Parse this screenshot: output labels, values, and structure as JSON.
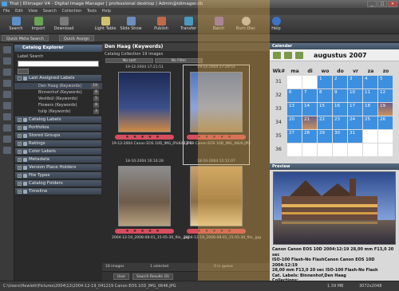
{
  "window": {
    "title": "Trial | IDimager V4 - Digital Image Manager | professional desktop | Admin@idimager.db",
    "controls": [
      "_",
      "□",
      "×"
    ]
  },
  "menu": [
    "File",
    "Edit",
    "View",
    "Search",
    "Collection",
    "Tools",
    "Help"
  ],
  "toolbar": {
    "buttons": [
      {
        "label": "Search",
        "icon": "search-icon"
      },
      {
        "label": "Import",
        "icon": "import-icon"
      },
      {
        "label": "Download",
        "icon": "download-icon"
      },
      {
        "label": "Light Table",
        "icon": "light-table-icon"
      },
      {
        "label": "Slide Show",
        "icon": "slide-show-icon"
      },
      {
        "label": "Publish",
        "icon": "publish-icon"
      },
      {
        "label": "Transfer",
        "icon": "transfer-icon"
      },
      {
        "label": "Batch",
        "icon": "batch-icon"
      },
      {
        "label": "Burn Disc",
        "icon": "burn-disc-icon"
      },
      {
        "label": "Help",
        "icon": "help-icon"
      }
    ]
  },
  "subtoolbar": {
    "quick_meta": "Quick Meta Search",
    "quick_assign": "Quick Assign"
  },
  "catalog_explorer": {
    "title": "Catalog Explorer",
    "label_search": "Label Search",
    "last_assigned": "Last Assigned Labels",
    "items": [
      {
        "label": "Den Haag (Keywords)",
        "count": "19"
      },
      {
        "label": "Binnenhof (Keywords)",
        "count": "8"
      },
      {
        "label": "Vestibül (Keywords)",
        "count": "5"
      },
      {
        "label": "Flowers (Keywords)",
        "count": "8"
      },
      {
        "label": "tulip (Keywords)",
        "count": "3"
      }
    ],
    "sections": [
      "Catalog Labels",
      "Portfolios",
      "Stored Groups",
      "Ratings",
      "Color Labels",
      "Metadata",
      "Version Place Holders",
      "File Types",
      "Catalog Folders",
      "Timeline"
    ]
  },
  "center": {
    "title": "Den Haag (Keywords)",
    "subtitle": "Catalog Collection  19 images",
    "sort_label": "No sort",
    "filter_label": "No Filter",
    "thumbs": [
      {
        "date": "19-12-2004 17:21:51",
        "file": "19-12-2004 Canon EOS 10D_IMG_0%647.JPG",
        "stars": "★★★★★",
        "colors": [
          "#1d2a55",
          "#3b4f8a",
          "#d08a44"
        ]
      },
      {
        "date": "19-12-2004 17:29:51",
        "file": "12-19 Canon EOS 10D_IMG_0826.JPG",
        "stars": "★★★★★",
        "colors": [
          "#5278c2",
          "#8ca5dc",
          "#a58a68"
        ]
      },
      {
        "date": "18-10-2004 16:16:28",
        "file": "2004-12-19_2008-08-01_15-05-30_file_.jpg",
        "stars": "★★★★★",
        "colors": [
          "#8d8d8d",
          "#6e5b4a",
          "#b7a07e"
        ]
      },
      {
        "date": "18-10-2004 12:12:07",
        "file": "2004-12-19_2008-08-01_15-05-30_file_.jpg",
        "stars": "★★★★★",
        "colors": [
          "#c8a26d",
          "#8a6d48",
          "#e7cf9e"
        ]
      }
    ],
    "status_left": "18 images",
    "status_mid": "1 selected",
    "status_right": "0 in queue",
    "tab_user": "User",
    "tab_search": "Search Results (0)"
  },
  "calendar": {
    "title": "Calendar",
    "month": "augustus 2007",
    "week_header": "Wk#",
    "days": [
      "ma",
      "di",
      "wo",
      "do",
      "vr",
      "za",
      "zo"
    ],
    "weeks": [
      "31",
      "32",
      "33",
      "34",
      "35",
      "36"
    ],
    "dates": [
      [
        "",
        "",
        "1",
        "2",
        "3",
        "4",
        "5"
      ],
      [
        "6",
        "7",
        "8",
        "9",
        "10",
        "11",
        "12"
      ],
      [
        "13",
        "14",
        "15",
        "16",
        "17",
        "18",
        "19"
      ],
      [
        "20",
        "21",
        "22",
        "23",
        "24",
        "25",
        "26"
      ],
      [
        "27",
        "28",
        "29",
        "30",
        "31",
        "",
        ""
      ],
      [
        "",
        "",
        "",
        "",
        "",
        "",
        ""
      ]
    ]
  },
  "preview": {
    "title": "Preview",
    "meta_line1": "Canon Canon EOS 10D 2004:12:19 28,00 mm F13,0 20 sec",
    "meta_line2": "ISO-100 Flash-No FlashCanon Canon EOS 10D 2004:12:19",
    "meta_line3": "28,00 mm F13,0 20 sec ISO-100 Flash-No Flash",
    "cat_labels": "Cat. Labels: Binnenhof,Den Haag",
    "collections": "Collections:"
  },
  "statusbar": {
    "path": "C:\\Users\\Hewlett\\Pictures\\2004\\12\\2004-12-19_041219 Canon EOS 10D_IMG_0646.JPG",
    "size": "1.39 MB",
    "dims": "3072x2048"
  }
}
